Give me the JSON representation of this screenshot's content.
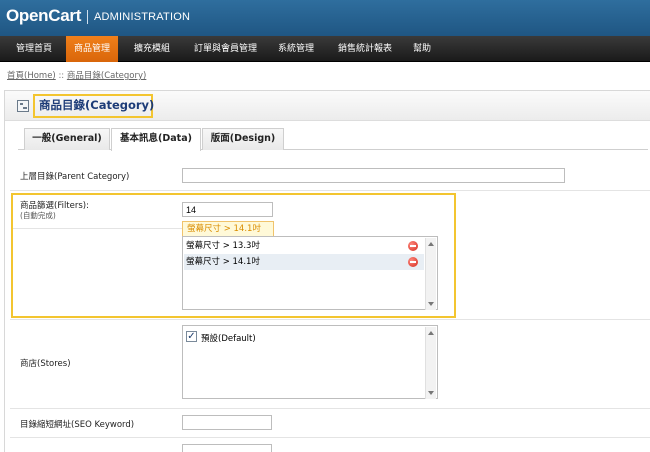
{
  "header": {
    "logo": "OpenCart",
    "subtitle": "ADMINISTRATION"
  },
  "menu": {
    "items": [
      {
        "label": "管理首頁"
      },
      {
        "label": "商品管理"
      },
      {
        "label": "擴充模組"
      },
      {
        "label": "訂單與會員管理"
      },
      {
        "label": "系統管理"
      },
      {
        "label": "銷售統計報表"
      },
      {
        "label": "幫助"
      }
    ],
    "active_index": 1
  },
  "breadcrumb": {
    "home": "首頁(Home)",
    "separator": "::",
    "current": "商品目錄(Category)"
  },
  "page_title": "商品目錄(Category)",
  "tabs": [
    {
      "label": "一般(General)"
    },
    {
      "label": "基本訊息(Data)"
    },
    {
      "label": "版面(Design)"
    }
  ],
  "selected_tab": 1,
  "form": {
    "parent_category": {
      "label": "上層目錄(Parent Category)",
      "value": ""
    },
    "filters": {
      "label": "商品篩選(Filters):",
      "help": "(自動完成)",
      "value": "14",
      "autocomplete_suggestion": "螢幕尺寸 > 14.1吋",
      "selected": [
        {
          "label": "螢幕尺寸 > 13.3吋"
        },
        {
          "label": "螢幕尺寸 > 14.1吋"
        }
      ]
    },
    "stores": {
      "label": "商店(Stores)",
      "options": [
        {
          "label": "預設(Default)",
          "checked": true
        }
      ]
    },
    "seo_keyword": {
      "label": "目錄縮短網址(SEO Keyword)",
      "value": ""
    }
  },
  "colors": {
    "header_blue": "#2a6594",
    "menu_active_orange": "#e8741a",
    "highlight_yellow": "#f3c530",
    "title_blue": "#1d3c78"
  }
}
